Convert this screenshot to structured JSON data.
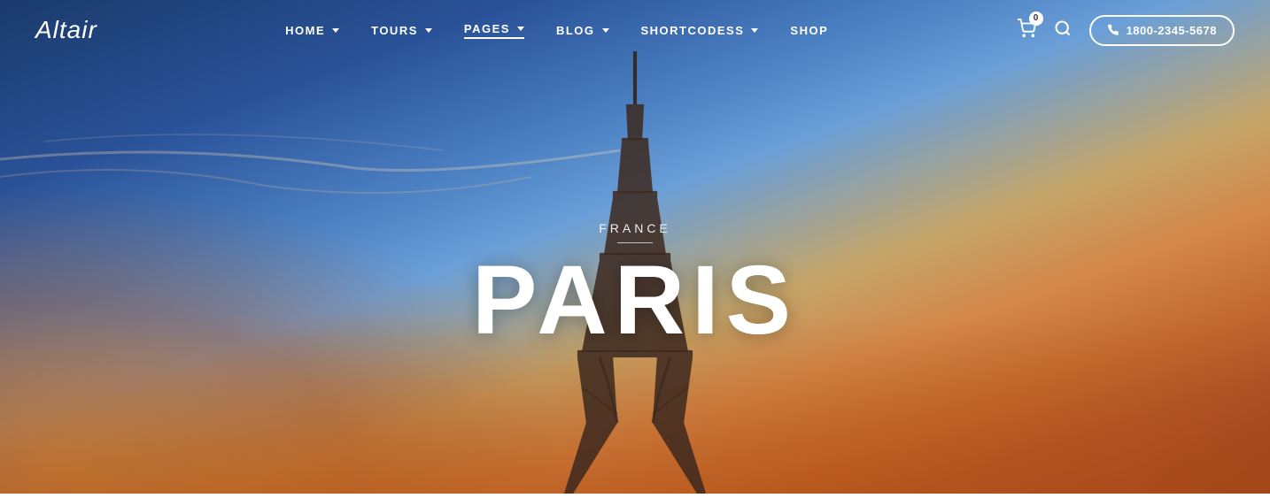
{
  "brand": {
    "logo_text": "Altair"
  },
  "navbar": {
    "links": [
      {
        "label": "HOME",
        "has_dropdown": true,
        "active": false
      },
      {
        "label": "TOURS",
        "has_dropdown": true,
        "active": false
      },
      {
        "label": "PAGES",
        "has_dropdown": true,
        "active": true
      },
      {
        "label": "BLOG",
        "has_dropdown": true,
        "active": false
      },
      {
        "label": "SHORTCODESS",
        "has_dropdown": true,
        "active": false
      },
      {
        "label": "SHOP",
        "has_dropdown": false,
        "active": false
      }
    ],
    "cart_count": "0",
    "phone": "1800-2345-5678"
  },
  "hero": {
    "subtitle": "FRANCE",
    "title": "PARIS"
  }
}
